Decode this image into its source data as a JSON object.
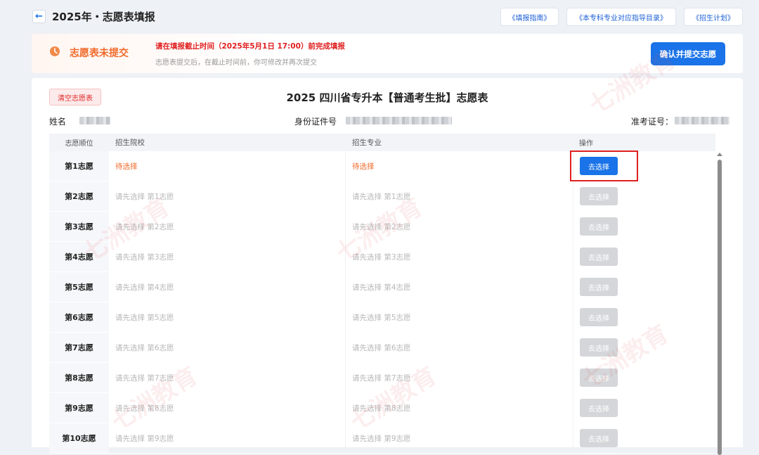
{
  "header": {
    "back_icon": "←",
    "title": "2025年・志愿表填报",
    "links": [
      "《填报指南》",
      "《本专科专业对应指导目录》",
      "《招生计划》"
    ]
  },
  "status": {
    "icon": "clock-icon",
    "title": "志愿表未提交",
    "deadline": "请在填报截止时间（2025年5月1日 17:00）前完成填报",
    "note": "志愿表提交后，在截止时间前，你可修改并再次提交",
    "confirm_label": "确认并提交志愿"
  },
  "form": {
    "clear_label": "清空志愿表",
    "title": "2025 四川省专升本【普通考生批】志愿表",
    "name_label": "姓名",
    "id_label": "身份证件号",
    "exam_label": "准考证号："
  },
  "table": {
    "headers": [
      "志愿顺位",
      "招生院校",
      "招生专业",
      "操作"
    ],
    "rows": [
      {
        "rank": "第1志愿",
        "school": "待选择",
        "major": "待选择",
        "action": "去选择"
      },
      {
        "rank": "第2志愿",
        "school": "请先选择 第1志愿",
        "major": "请先选择 第1志愿",
        "action": "去选择"
      },
      {
        "rank": "第3志愿",
        "school": "请先选择 第2志愿",
        "major": "请先选择 第2志愿",
        "action": "去选择"
      },
      {
        "rank": "第4志愿",
        "school": "请先选择 第3志愿",
        "major": "请先选择 第3志愿",
        "action": "去选择"
      },
      {
        "rank": "第5志愿",
        "school": "请先选择 第4志愿",
        "major": "请先选择 第4志愿",
        "action": "去选择"
      },
      {
        "rank": "第6志愿",
        "school": "请先选择 第5志愿",
        "major": "请先选择 第5志愿",
        "action": "去选择"
      },
      {
        "rank": "第7志愿",
        "school": "请先选择 第6志愿",
        "major": "请先选择 第6志愿",
        "action": "去选择"
      },
      {
        "rank": "第8志愿",
        "school": "请先选择 第7志愿",
        "major": "请先选择 第7志愿",
        "action": "去选择"
      },
      {
        "rank": "第9志愿",
        "school": "请先选择 第8志愿",
        "major": "请先选择 第8志愿",
        "action": "去选择"
      },
      {
        "rank": "第10志愿",
        "school": "请先选择 第9志愿",
        "major": "请先选择 第9志愿",
        "action": "去选择"
      }
    ]
  },
  "colors": {
    "accent": "#1a73e8",
    "warning": "#f06a2a",
    "error": "#e02020",
    "disabled": "#d4d6d9"
  },
  "watermark": "七洲教育"
}
